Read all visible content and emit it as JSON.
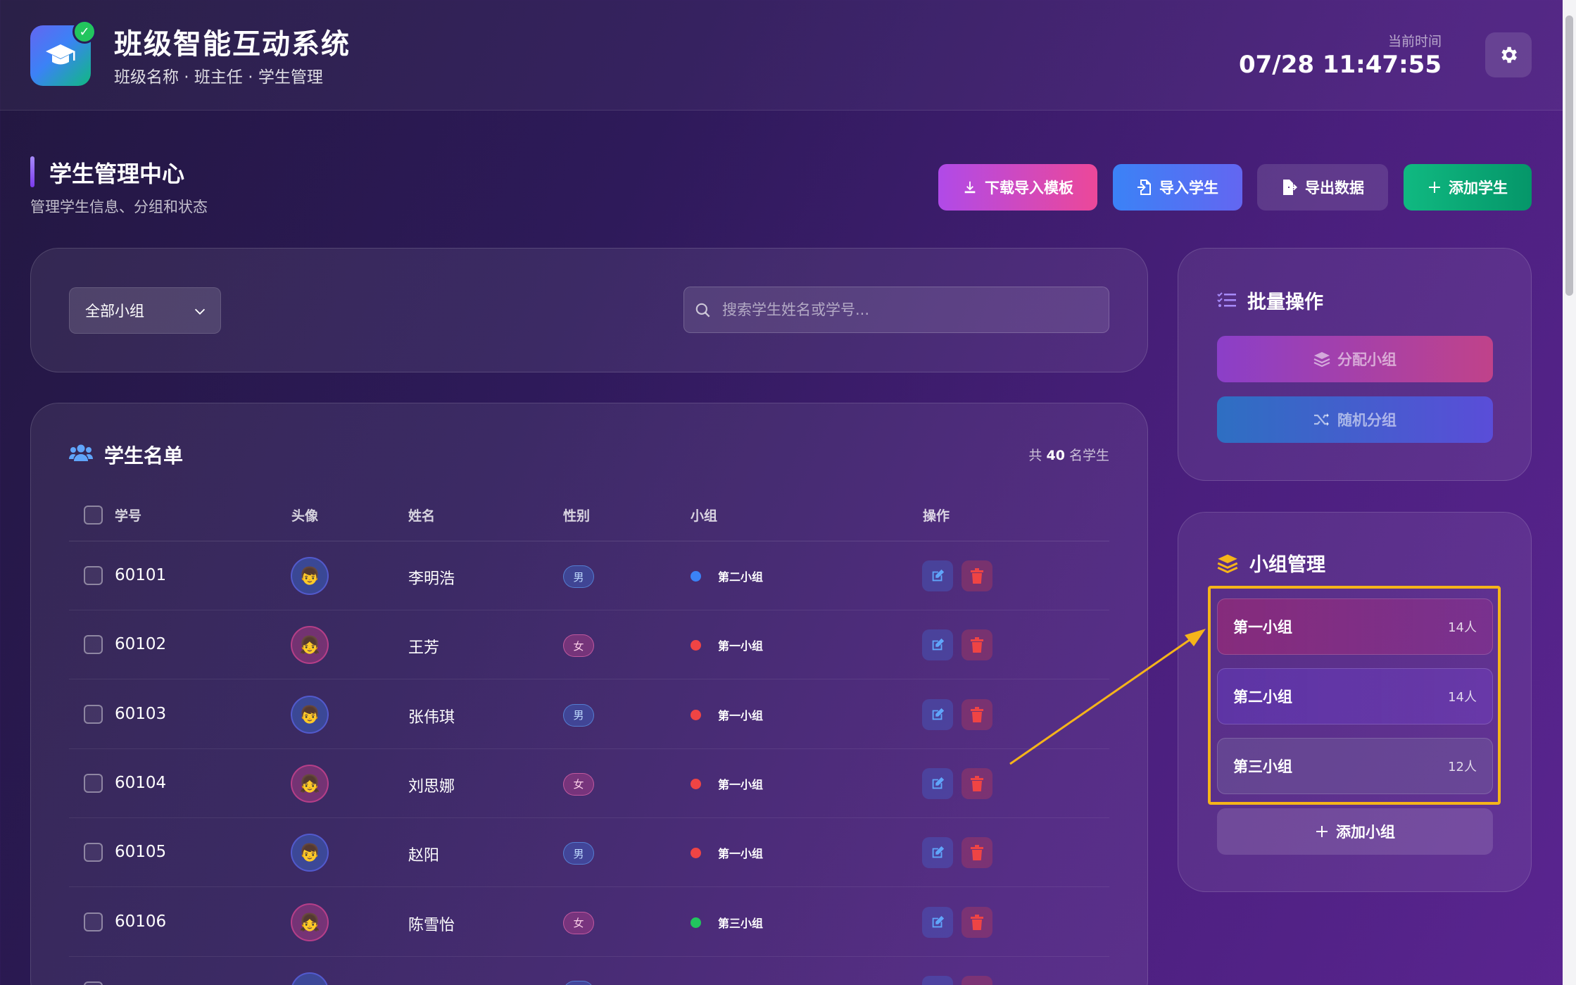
{
  "header": {
    "title": "班级智能互动系统",
    "subtitle": "班级名称 · 班主任 · 学生管理",
    "time_label": "当前时间",
    "time_value": "07/28 11:47:55"
  },
  "section": {
    "title": "学生管理中心",
    "subtitle": "管理学生信息、分组和状态"
  },
  "toolbar": {
    "download_template": "下载导入模板",
    "import_students": "导入学生",
    "export_data": "导出数据",
    "add_student": "添加学生"
  },
  "filter": {
    "group_select": "全部小组",
    "search_placeholder": "搜索学生姓名或学号..."
  },
  "student_list": {
    "title": "学生名单",
    "count_prefix": "共",
    "count": "40",
    "count_suffix": "名学生",
    "columns": [
      "学号",
      "头像",
      "姓名",
      "性别",
      "小组",
      "操作"
    ],
    "rows": [
      {
        "id": "60101",
        "avatar": "👦",
        "name": "李明浩",
        "gender": "男",
        "group": "第二小组",
        "group_color": "#3b82f6"
      },
      {
        "id": "60102",
        "avatar": "👧",
        "name": "王芳",
        "gender": "女",
        "group": "第一小组",
        "group_color": "#ef4444"
      },
      {
        "id": "60103",
        "avatar": "👦",
        "name": "张伟琪",
        "gender": "男",
        "group": "第一小组",
        "group_color": "#ef4444"
      },
      {
        "id": "60104",
        "avatar": "👧",
        "name": "刘思娜",
        "gender": "女",
        "group": "第一小组",
        "group_color": "#ef4444"
      },
      {
        "id": "60105",
        "avatar": "👦",
        "name": "赵阳",
        "gender": "男",
        "group": "第一小组",
        "group_color": "#ef4444"
      },
      {
        "id": "60106",
        "avatar": "👧",
        "name": "陈雪怡",
        "gender": "女",
        "group": "第三小组",
        "group_color": "#22c55e"
      }
    ]
  },
  "batch": {
    "title": "批量操作",
    "assign_group": "分配小组",
    "random_group": "随机分组"
  },
  "groups": {
    "title": "小组管理",
    "items": [
      {
        "name": "第一小组",
        "count": "14人"
      },
      {
        "name": "第二小组",
        "count": "14人"
      },
      {
        "name": "第三小组",
        "count": "12人"
      }
    ],
    "add_label": "添加小组"
  },
  "colors": {
    "highlight": "#f5b41a",
    "male": "#3b82f6",
    "female": "#ec4899",
    "success": "#10b981"
  }
}
